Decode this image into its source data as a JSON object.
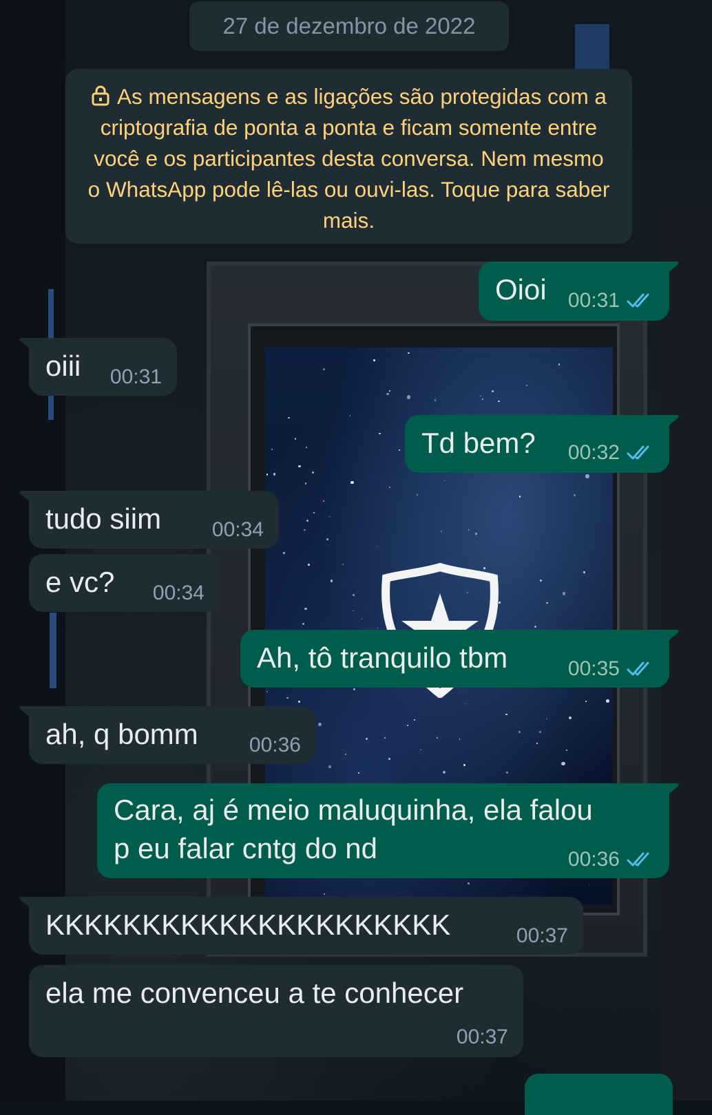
{
  "chat": {
    "date_label": "27 de dezembro de 2022",
    "encryption_notice": "As mensagens e as ligações são protegidas com a criptografia de ponta a ponta e ficam somente entre você e os participantes desta conversa. Nem mesmo o WhatsApp pode lê-las ou ouvi-las. Toque para saber mais.",
    "messages": [
      {
        "direction": "out",
        "lines": [
          "Oioi"
        ],
        "time": "00:31",
        "status": "read"
      },
      {
        "direction": "in",
        "lines": [
          "oiii"
        ],
        "time": "00:31"
      },
      {
        "direction": "out",
        "lines": [
          "Td bem?"
        ],
        "time": "00:32",
        "status": "read"
      },
      {
        "direction": "in",
        "lines": [
          "tudo siim"
        ],
        "time": "00:34"
      },
      {
        "direction": "in",
        "lines": [
          "e vc?"
        ],
        "time": "00:34"
      },
      {
        "direction": "out",
        "lines": [
          "Ah, tô tranquilo tbm"
        ],
        "time": "00:35",
        "status": "read"
      },
      {
        "direction": "in",
        "lines": [
          "ah, q bomm"
        ],
        "time": "00:36"
      },
      {
        "direction": "out",
        "lines": [
          "Cara, aj é meio maluquinha, ela falou",
          "p eu falar cntg do nd"
        ],
        "time": "00:36",
        "status": "read"
      },
      {
        "direction": "in",
        "lines": [
          "KKKKKKKKKKKKKKKKKKKKK"
        ],
        "time": "00:37"
      },
      {
        "direction": "in",
        "lines": [
          "ela me convenceu a te conhecer"
        ],
        "time": "00:37"
      }
    ]
  },
  "colors": {
    "incoming_bubble": "#1f2c34",
    "outgoing_bubble": "#005c4b",
    "notice_text": "#ffd279",
    "read_ticks": "#53bdeb"
  },
  "icons": {
    "lock": "lock-icon",
    "read_receipt": "double-check-icon",
    "wallpaper_emblem": "shield-star-icon"
  }
}
